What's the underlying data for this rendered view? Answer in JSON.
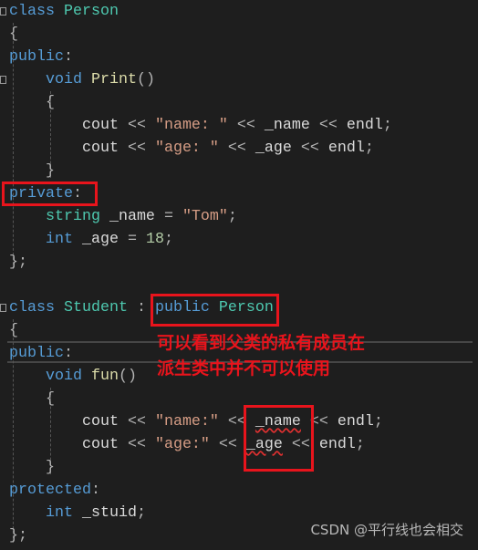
{
  "colors": {
    "background": "#1e1e1e",
    "keyword": "#569cd6",
    "type": "#4ec9b0",
    "function": "#dcdcaa",
    "string": "#d69d85",
    "annotation": "#e8141c"
  },
  "code_lines": [
    [
      [
        "class ",
        "kw"
      ],
      [
        "Person",
        "ty"
      ]
    ],
    [
      [
        "{",
        "op"
      ]
    ],
    [
      [
        "public",
        "kw"
      ],
      [
        ":",
        "op"
      ]
    ],
    [
      [
        "    "
      ],
      [
        "void ",
        "kw"
      ],
      [
        "Print",
        "fn"
      ],
      [
        "()",
        "op"
      ]
    ],
    [
      [
        "    "
      ],
      [
        "{",
        "op"
      ]
    ],
    [
      [
        "        "
      ],
      [
        "cout ",
        "id"
      ],
      [
        "<< ",
        "op"
      ],
      [
        "\"name: \" ",
        "str"
      ],
      [
        "<< ",
        "op"
      ],
      [
        "_name ",
        "id"
      ],
      [
        "<< ",
        "op"
      ],
      [
        "endl",
        "id"
      ],
      [
        ";",
        "op"
      ]
    ],
    [
      [
        "        "
      ],
      [
        "cout ",
        "id"
      ],
      [
        "<< ",
        "op"
      ],
      [
        "\"age: \" ",
        "str"
      ],
      [
        "<< ",
        "op"
      ],
      [
        "_age ",
        "id"
      ],
      [
        "<< ",
        "op"
      ],
      [
        "endl",
        "id"
      ],
      [
        ";",
        "op"
      ]
    ],
    [
      [
        "    "
      ],
      [
        "}",
        "op"
      ]
    ],
    [
      [
        "private",
        "kw"
      ],
      [
        ":",
        "op"
      ]
    ],
    [
      [
        "    "
      ],
      [
        "string ",
        "ty"
      ],
      [
        "_name ",
        "id"
      ],
      [
        "= ",
        "op"
      ],
      [
        "\"Tom\"",
        "str"
      ],
      [
        ";",
        "op"
      ]
    ],
    [
      [
        "    "
      ],
      [
        "int ",
        "kw"
      ],
      [
        "_age ",
        "id"
      ],
      [
        "= ",
        "op"
      ],
      [
        "18",
        "num"
      ],
      [
        ";",
        "op"
      ]
    ],
    [
      [
        "};",
        "op"
      ]
    ],
    [],
    [
      [
        "class ",
        "kw"
      ],
      [
        "Student ",
        "ty"
      ],
      [
        ": ",
        "op"
      ],
      [
        "public ",
        "kw"
      ],
      [
        "Person",
        "ty"
      ]
    ],
    [
      [
        "{",
        "op"
      ]
    ],
    [
      [
        "public",
        "kw"
      ],
      [
        ":",
        "op"
      ]
    ],
    [
      [
        "    "
      ],
      [
        "void ",
        "kw"
      ],
      [
        "fun",
        "fn"
      ],
      [
        "()",
        "op"
      ]
    ],
    [
      [
        "    "
      ],
      [
        "{",
        "op"
      ]
    ],
    [
      [
        "        "
      ],
      [
        "cout ",
        "id"
      ],
      [
        "<< ",
        "op"
      ],
      [
        "\"name:\" ",
        "str"
      ],
      [
        "<< ",
        "op"
      ],
      [
        "_name",
        "id err"
      ],
      [
        " "
      ],
      [
        "<< ",
        "op"
      ],
      [
        "endl",
        "id"
      ],
      [
        ";",
        "op"
      ]
    ],
    [
      [
        "        "
      ],
      [
        "cout ",
        "id"
      ],
      [
        "<< ",
        "op"
      ],
      [
        "\"age:\" ",
        "str"
      ],
      [
        "<< ",
        "op"
      ],
      [
        "_age",
        "id err"
      ],
      [
        " "
      ],
      [
        "<< ",
        "op"
      ],
      [
        "endl",
        "id"
      ],
      [
        ";",
        "op"
      ]
    ],
    [
      [
        "    "
      ],
      [
        "}",
        "op"
      ]
    ],
    [
      [
        "protected",
        "kw"
      ],
      [
        ":",
        "op"
      ]
    ],
    [
      [
        "    "
      ],
      [
        "int ",
        "kw"
      ],
      [
        "_stuid",
        "id"
      ],
      [
        ";",
        "op"
      ]
    ],
    [
      [
        "};",
        "op"
      ]
    ]
  ],
  "annotation": {
    "line1": "可以看到父类的私有成员在",
    "line2": "派生类中并不可以使用"
  },
  "watermark": "CSDN @平行线也会相交"
}
